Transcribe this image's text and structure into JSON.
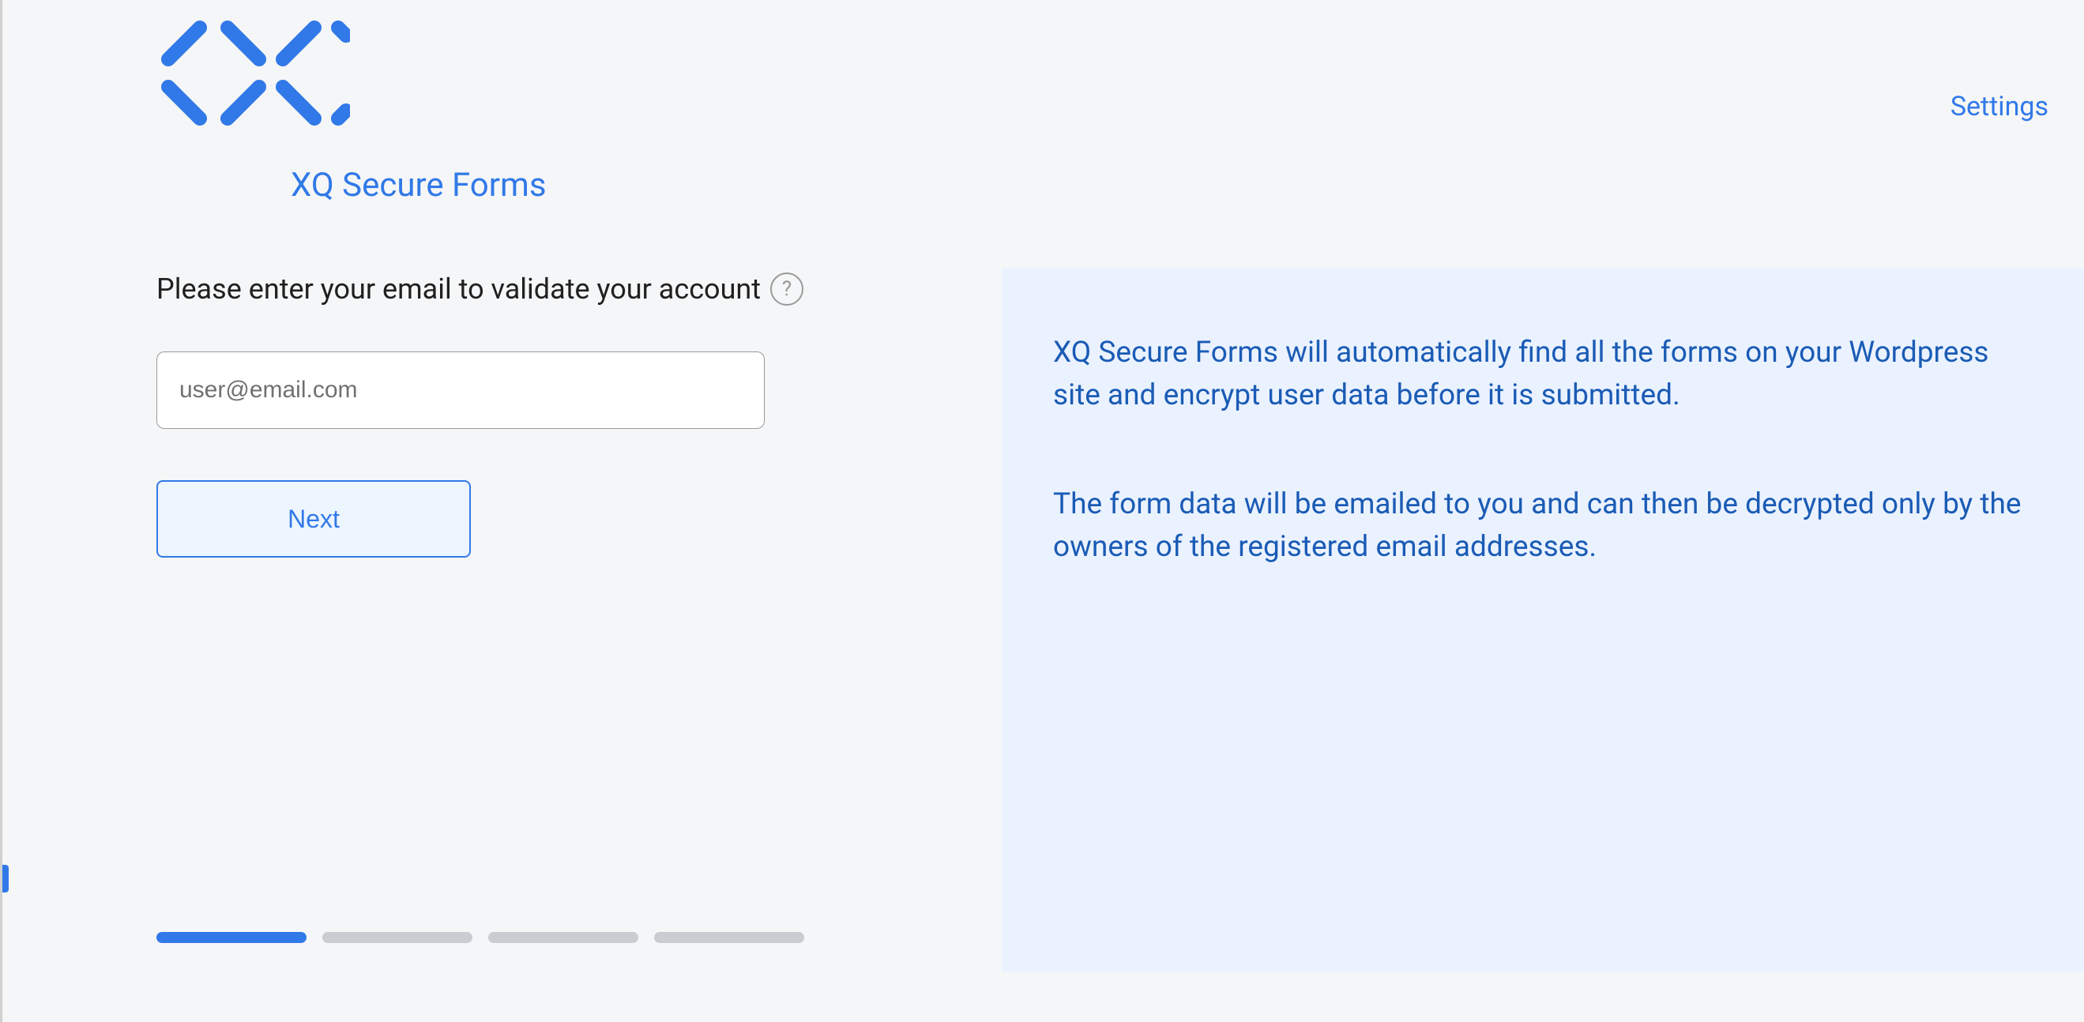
{
  "header": {
    "settings_label": "Settings"
  },
  "title": "XQ Secure Forms",
  "form": {
    "prompt": "Please enter your email to validate your account",
    "help_glyph": "?",
    "email_placeholder": "user@email.com",
    "next_label": "Next"
  },
  "info": {
    "para1": "XQ Secure Forms will automatically find all the forms on your Wordpress site and encrypt user data before it is submitted.",
    "para2": "The form data will be emailed to you and can then be decrypted only by the owners of the registered email addresses."
  },
  "progress": {
    "total_steps": 4,
    "current_step": 1
  }
}
